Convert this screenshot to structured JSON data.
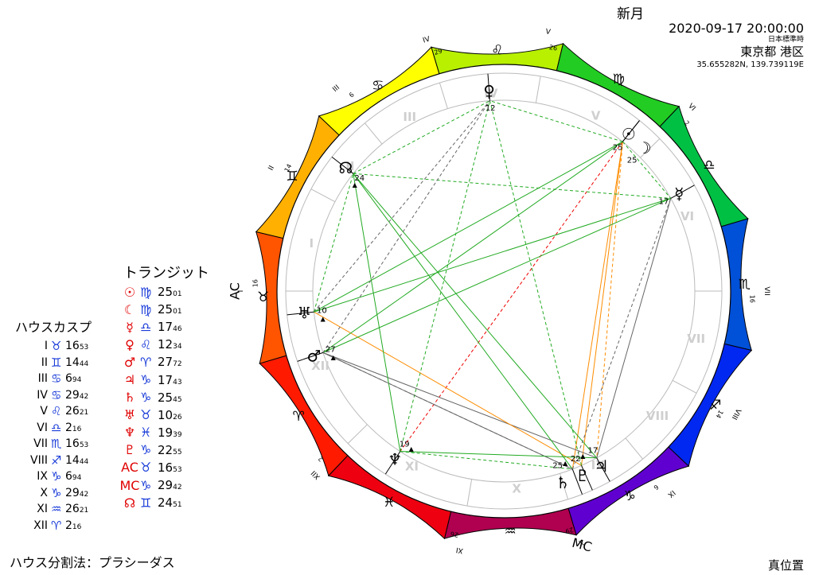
{
  "header": {
    "title": "新月",
    "datetime": "2020-09-17 20:00:00",
    "timezone": "日本標準時",
    "place": "東京都 港区",
    "coords": "35.655282N, 139.739119E"
  },
  "footer": {
    "house_system": "ハウス分割法：プラシーダス",
    "position_mode": "真位置"
  },
  "cusp_table": {
    "title": "ハウスカスプ",
    "rows": [
      {
        "label": "I",
        "sign": "♉",
        "deg": "16",
        "min": "53"
      },
      {
        "label": "II",
        "sign": "♊",
        "deg": "14",
        "min": "44"
      },
      {
        "label": "III",
        "sign": "♋",
        "deg": "6",
        "min": "94"
      },
      {
        "label": "IV",
        "sign": "♋",
        "deg": "29",
        "min": "42"
      },
      {
        "label": "V",
        "sign": "♌",
        "deg": "26",
        "min": "21"
      },
      {
        "label": "VI",
        "sign": "♎",
        "deg": "2",
        "min": "16"
      },
      {
        "label": "VII",
        "sign": "♏",
        "deg": "16",
        "min": "53"
      },
      {
        "label": "VIII",
        "sign": "♐",
        "deg": "14",
        "min": "44"
      },
      {
        "label": "IX",
        "sign": "♑",
        "deg": "6",
        "min": "94"
      },
      {
        "label": "X",
        "sign": "♑",
        "deg": "29",
        "min": "42"
      },
      {
        "label": "XI",
        "sign": "♒",
        "deg": "26",
        "min": "21"
      },
      {
        "label": "XII",
        "sign": "♈",
        "deg": "2",
        "min": "16"
      }
    ]
  },
  "transit_table": {
    "title": "トランジット",
    "rows": [
      {
        "planet": "☉",
        "sign": "♍",
        "deg": "25",
        "min": "01"
      },
      {
        "planet": "☾",
        "sign": "♍",
        "deg": "25",
        "min": "01"
      },
      {
        "planet": "☿",
        "sign": "♎",
        "deg": "17",
        "min": "46"
      },
      {
        "planet": "♀",
        "sign": "♌",
        "deg": "12",
        "min": "34"
      },
      {
        "planet": "♂",
        "sign": "♈",
        "deg": "27",
        "min": "72"
      },
      {
        "planet": "♃",
        "sign": "♑",
        "deg": "17",
        "min": "43"
      },
      {
        "planet": "♄",
        "sign": "♑",
        "deg": "25",
        "min": "45"
      },
      {
        "planet": "♅",
        "sign": "♉",
        "deg": "10",
        "min": "26"
      },
      {
        "planet": "♆",
        "sign": "♓",
        "deg": "19",
        "min": "39"
      },
      {
        "planet": "♇",
        "sign": "♑",
        "deg": "22",
        "min": "55"
      },
      {
        "planet": "AC",
        "sign": "♉",
        "deg": "16",
        "min": "53"
      },
      {
        "planet": "MC",
        "sign": "♑",
        "deg": "29",
        "min": "42"
      },
      {
        "planet": "☊",
        "sign": "♊",
        "deg": "24",
        "min": "51"
      }
    ]
  },
  "wheel": {
    "asc_longitude": 46.53,
    "signs": [
      {
        "glyph": "♈",
        "color": "#ff1a00"
      },
      {
        "glyph": "♉",
        "color": "#ff5400"
      },
      {
        "glyph": "♊",
        "color": "#ffb000"
      },
      {
        "glyph": "♋",
        "color": "#ffff00"
      },
      {
        "glyph": "♌",
        "color": "#b8f000"
      },
      {
        "glyph": "♍",
        "color": "#22cc22"
      },
      {
        "glyph": "♎",
        "color": "#00c044"
      },
      {
        "glyph": "♏",
        "color": "#0050d8"
      },
      {
        "glyph": "♐",
        "color": "#0028f0"
      },
      {
        "glyph": "♑",
        "color": "#6000d0"
      },
      {
        "glyph": "♒",
        "color": "#b00050"
      },
      {
        "glyph": "♓",
        "color": "#ee0010"
      }
    ],
    "cusps": [
      46.53,
      74.44,
      96.94,
      119.42,
      146.21,
      182.16,
      226.53,
      254.44,
      276.94,
      299.42,
      326.21,
      2.16
    ],
    "cusp_numbers": [
      "16",
      "14",
      "6",
      "29",
      "26",
      "2",
      "16",
      "14",
      "6",
      "29",
      "26",
      "2"
    ],
    "house_labels": [
      "I",
      "II",
      "III",
      "IV",
      "V",
      "VI",
      "VII",
      "VIII",
      "IX",
      "X",
      "XI",
      "XII"
    ],
    "angle_labels": {
      "asc": "AC",
      "mc": "MC"
    },
    "planets": [
      {
        "glyph": "☉",
        "longitude": 175.01,
        "deg": "25",
        "retro": false
      },
      {
        "glyph": "☽",
        "longitude": 175.01,
        "deg": "25",
        "retro": false
      },
      {
        "glyph": "☿",
        "longitude": 197.46,
        "deg": "17",
        "retro": false
      },
      {
        "glyph": "♀",
        "longitude": 132.34,
        "deg": "12",
        "retro": false
      },
      {
        "glyph": "♂",
        "longitude": 27.72,
        "deg": "27",
        "retro": true
      },
      {
        "glyph": "♃",
        "longitude": 287.43,
        "deg": "17",
        "retro": false
      },
      {
        "glyph": "♄",
        "longitude": 295.45,
        "deg": "25",
        "retro": true
      },
      {
        "glyph": "♅",
        "longitude": 40.26,
        "deg": "10",
        "retro": true
      },
      {
        "glyph": "♆",
        "longitude": 349.39,
        "deg": "19",
        "retro": true
      },
      {
        "glyph": "♇",
        "longitude": 292.55,
        "deg": "22",
        "retro": true
      },
      {
        "glyph": "☊",
        "longitude": 84.51,
        "deg": "24",
        "retro": true
      }
    ],
    "aspects": [
      {
        "a": "☉",
        "b": "♄",
        "color": "#ff8c00",
        "style": "solid"
      },
      {
        "a": "☉",
        "b": "♇",
        "color": "#ff8c00",
        "style": "solid"
      },
      {
        "a": "☉",
        "b": "♃",
        "color": "#ff8c00",
        "style": "dashed"
      },
      {
        "a": "☉",
        "b": "♅",
        "color": "#22aa22",
        "style": "solid"
      },
      {
        "a": "☉",
        "b": "♆",
        "color": "#ee0000",
        "style": "dashed"
      },
      {
        "a": "☉",
        "b": "♀",
        "color": "#22aa22",
        "style": "dashed"
      },
      {
        "a": "☉",
        "b": "☿",
        "color": "#22aa22",
        "style": "dashed"
      },
      {
        "a": "♃",
        "b": "♂",
        "color": "#666666",
        "style": "solid"
      },
      {
        "a": "♄",
        "b": "♂",
        "color": "#666666",
        "style": "solid"
      },
      {
        "a": "♇",
        "b": "♅",
        "color": "#ff8c00",
        "style": "solid"
      },
      {
        "a": "♃",
        "b": "☊",
        "color": "#22aa22",
        "style": "solid"
      },
      {
        "a": "♄",
        "b": "☊",
        "color": "#22aa22",
        "style": "solid"
      },
      {
        "a": "♇",
        "b": "♀",
        "color": "#22aa22",
        "style": "dashed"
      },
      {
        "a": "♃",
        "b": "☿",
        "color": "#666666",
        "style": "solid"
      },
      {
        "a": "♆",
        "b": "♃",
        "color": "#22aa22",
        "style": "solid"
      },
      {
        "a": "♆",
        "b": "♄",
        "color": "#22aa22",
        "style": "dashed"
      },
      {
        "a": "♆",
        "b": "☊",
        "color": "#22aa22",
        "style": "solid"
      },
      {
        "a": "♆",
        "b": "♀",
        "color": "#22aa22",
        "style": "dashed"
      },
      {
        "a": "♂",
        "b": "☿",
        "color": "#22aa22",
        "style": "solid"
      },
      {
        "a": "♂",
        "b": "☉",
        "color": "#22aa22",
        "style": "solid"
      },
      {
        "a": "♂",
        "b": "♄",
        "color": "#666666",
        "style": "dashed"
      },
      {
        "a": "♅",
        "b": "♀",
        "color": "#666666",
        "style": "dashed"
      },
      {
        "a": "♅",
        "b": "☊",
        "color": "#22aa22",
        "style": "dashed"
      },
      {
        "a": "♅",
        "b": "☿",
        "color": "#22aa22",
        "style": "solid"
      },
      {
        "a": "☊",
        "b": "♀",
        "color": "#22aa22",
        "style": "dashed"
      },
      {
        "a": "☊",
        "b": "☿",
        "color": "#22aa22",
        "style": "dashed"
      },
      {
        "a": "♂",
        "b": "♀",
        "color": "#666666",
        "style": "dashed"
      },
      {
        "a": "♄",
        "b": "☿",
        "color": "#666666",
        "style": "dashed"
      }
    ]
  }
}
